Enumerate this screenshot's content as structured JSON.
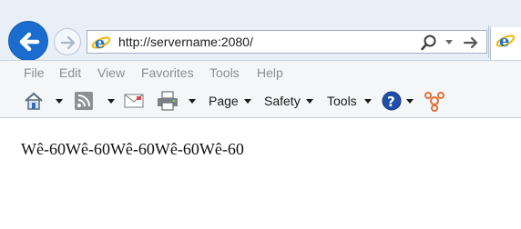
{
  "address_bar": {
    "url": "http://servername:2080/"
  },
  "menu": {
    "items": [
      "File",
      "Edit",
      "View",
      "Favorites",
      "Tools",
      "Help"
    ]
  },
  "command_bar": {
    "page_label": "Page",
    "safety_label": "Safety",
    "tools_label": "Tools"
  },
  "page": {
    "text": "Wê-60Wê-60Wê-60Wê-60Wê-60"
  },
  "icons": {
    "back": "back-arrow-icon",
    "forward": "forward-arrow-icon",
    "ie_logo": "internet-explorer-icon",
    "search": "search-icon",
    "go": "go-arrow-icon",
    "home": "home-icon",
    "feeds": "rss-feed-icon",
    "mail": "mail-icon",
    "print": "printer-icon",
    "help": "help-icon",
    "research": "research-icon"
  },
  "colors": {
    "accent": "#1b6ccf",
    "chrome_bg": "#e8eff7",
    "menu_disabled_text": "#8a8d91"
  }
}
